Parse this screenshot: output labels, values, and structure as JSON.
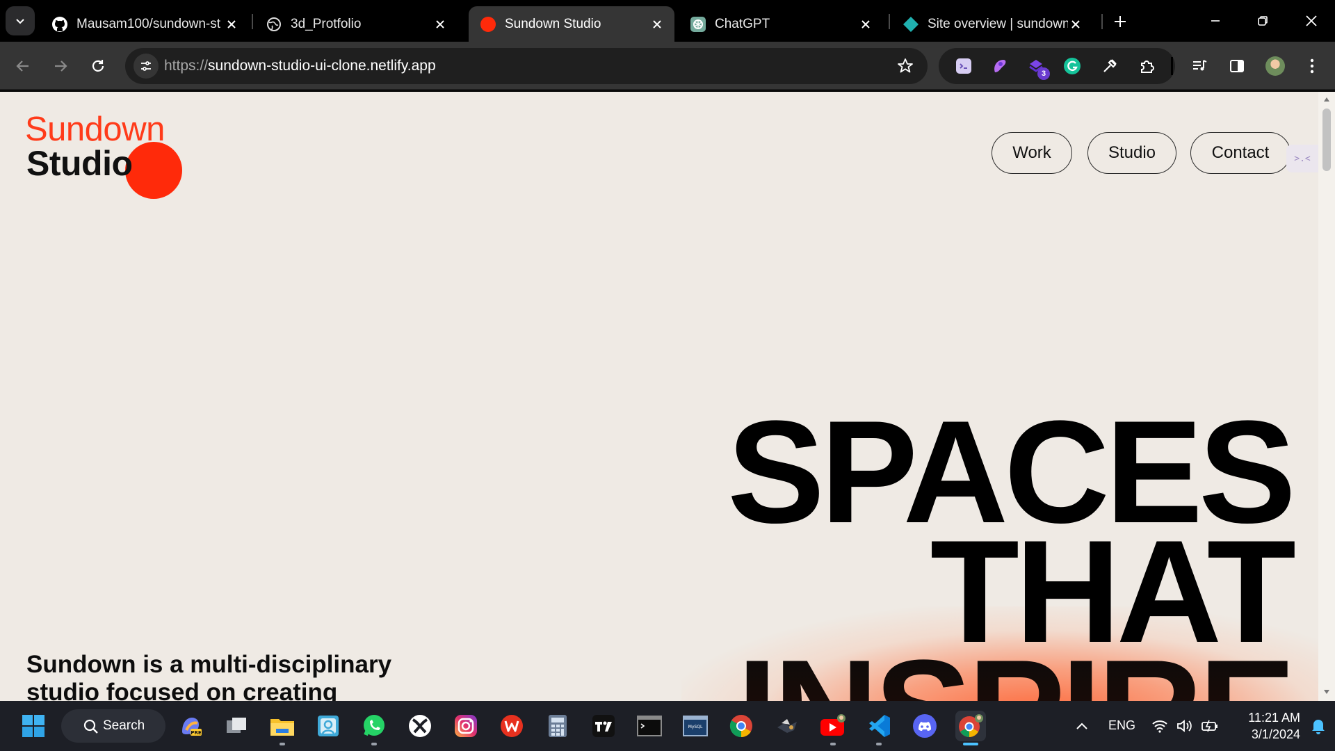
{
  "browser": {
    "tabs": [
      {
        "title": "Mausam100/sundown-st",
        "icon": "github-icon"
      },
      {
        "title": "3d_Protfolio",
        "icon": "globe-icon"
      },
      {
        "title": "Sundown Studio",
        "icon": "red-dot-icon",
        "active": true
      },
      {
        "title": "ChatGPT",
        "icon": "chatgpt-icon"
      },
      {
        "title": "Site overview | sundown-",
        "icon": "netlify-icon"
      }
    ],
    "url_scheme": "https://",
    "url_host": "sundown-studio-ui-clone.netlify.app",
    "extension_badge": "3"
  },
  "page": {
    "logo_top": "Sundown",
    "logo_bottom": "Studio",
    "nav": [
      "Work",
      "Studio",
      "Contact"
    ],
    "side_tab": ">.<",
    "hero": [
      "SPACES",
      "THAT",
      "INSPIRE"
    ],
    "intro": "Sundown is a multi-disciplinary studio focused on creating",
    "accent_color": "#ff3b1a"
  },
  "taskbar": {
    "search_label": "Search",
    "lang": "ENG",
    "time": "11:21 AM",
    "date": "3/1/2024"
  }
}
